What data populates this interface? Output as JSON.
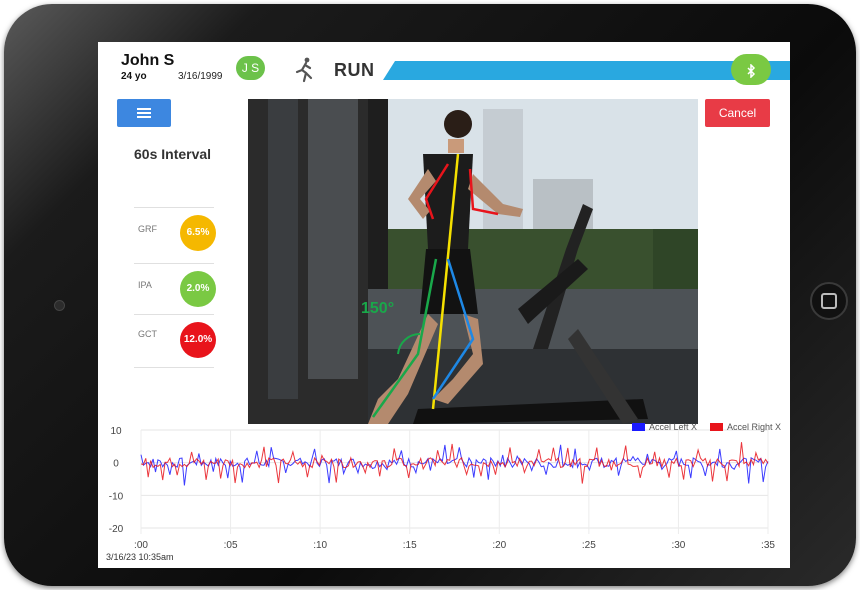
{
  "header": {
    "patient_name": "John S",
    "age": "24 yo",
    "dob": "3/16/1999",
    "initials": "J S",
    "activity": "RUN",
    "bluetooth_icon": "bluetooth-icon",
    "accent_color": "#29a8e0"
  },
  "controls": {
    "menu_icon": "hamburger-menu-icon",
    "cancel_label": "Cancel"
  },
  "sidebar": {
    "interval_label": "60s Interval",
    "metrics": [
      {
        "label": "GRF",
        "value": "6.5%",
        "color": "#f5b800"
      },
      {
        "label": "IPA",
        "value": "2.0%",
        "color": "#7ac943"
      },
      {
        "label": "GCT",
        "value": "12.0%",
        "color": "#e8141b"
      }
    ]
  },
  "overlay": {
    "angle_label": "150°"
  },
  "chart_data": {
    "type": "line",
    "title": "",
    "xlabel": "",
    "ylabel": "",
    "x_ticks": [
      ":00",
      ":05",
      ":10",
      ":15",
      ":20",
      ":25",
      ":30",
      ":35"
    ],
    "y_ticks": [
      "10",
      "0",
      "-10",
      "-20"
    ],
    "xlim": [
      0,
      35
    ],
    "ylim": [
      -20,
      10
    ],
    "grid": true,
    "legend_position": "top-right",
    "timestamp": "3/16/23 10:35am",
    "series": [
      {
        "name": "Accel Left X",
        "color": "#1a1aff",
        "amplitude": 3
      },
      {
        "name": "Accel Right X",
        "color": "#e8141b",
        "amplitude": 3
      }
    ]
  }
}
